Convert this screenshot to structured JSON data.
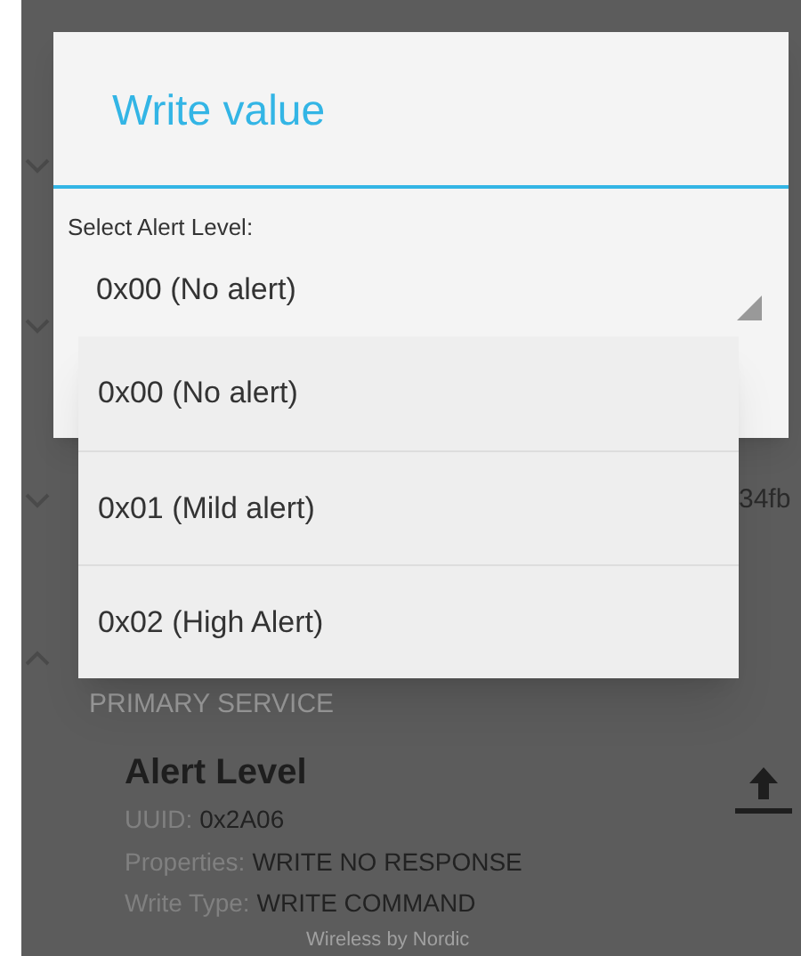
{
  "background": {
    "partial_text": "34fb",
    "section_label": "PRIMARY SERVICE",
    "characteristic": {
      "name": "Alert Level",
      "uuid_label": "UUID:",
      "uuid": "0x2A06",
      "properties_label": "Properties:",
      "properties": "WRITE NO RESPONSE",
      "write_type_label": "Write Type:",
      "write_type": "WRITE COMMAND"
    },
    "footer": "Wireless by Nordic"
  },
  "dialog": {
    "title": "Write value",
    "field_label": "Select Alert Level:",
    "spinner": {
      "value": "0x00 (No alert)"
    }
  },
  "dropdown": {
    "options": [
      {
        "label": "0x00 (No alert)"
      },
      {
        "label": "0x01 (Mild alert)"
      },
      {
        "label": "0x02 (High Alert)"
      }
    ]
  }
}
